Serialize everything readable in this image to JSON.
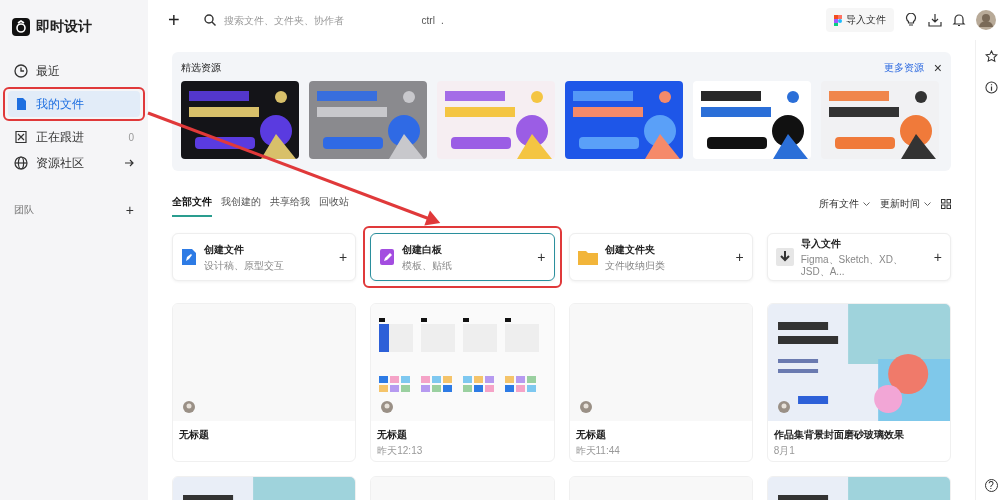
{
  "app": {
    "name": "即时设计"
  },
  "sidebar": {
    "items": [
      {
        "label": "最近",
        "selected": false,
        "marked": false
      },
      {
        "label": "我的文件",
        "selected": true,
        "marked": true
      },
      {
        "label": "正在跟进",
        "selected": false,
        "marked": false,
        "count": "0"
      },
      {
        "label": "资源社区",
        "selected": false,
        "marked": false,
        "arrow": true
      }
    ],
    "section": {
      "label": "团队",
      "add": "+"
    }
  },
  "topbar": {
    "new_button": "+",
    "search": {
      "placeholder": "搜索文件、文件夹、协作者",
      "keys": [
        "ctrl",
        "."
      ]
    },
    "import_button": "导入文件"
  },
  "banner": {
    "title": "精选资源",
    "more_link": "更多资源",
    "close": "×",
    "items": [
      {
        "kind": "picture"
      },
      {
        "kind": "picture"
      },
      {
        "kind": "picture"
      },
      {
        "kind": "picture"
      },
      {
        "kind": "picture"
      },
      {
        "kind": "picture"
      }
    ]
  },
  "tabs": [
    {
      "label": "全部文件",
      "selected": true
    },
    {
      "label": "我创建的",
      "selected": false
    },
    {
      "label": "共享给我",
      "selected": false
    },
    {
      "label": "回收站",
      "selected": false
    }
  ],
  "filters": [
    "所有文件",
    "更新时间"
  ],
  "create_cards": [
    {
      "title": "创建文件",
      "subtitle": "设计稿、原型交互",
      "add": "+",
      "highlighted": false,
      "marked": false
    },
    {
      "title": "创建白板",
      "subtitle": "模板、贴纸",
      "add": "+",
      "highlighted": true,
      "marked": true
    },
    {
      "title": "创建文件夹",
      "subtitle": "文件收纳归类",
      "add": "+",
      "highlighted": false,
      "marked": false
    },
    {
      "title": "导入文件",
      "subtitle": "Figma、Sketch、XD、JSD、A...",
      "add": "+",
      "highlighted": false,
      "marked": false
    }
  ],
  "files": [
    {
      "title": "无标题",
      "kind": "blank"
    },
    {
      "title": "无标题",
      "time": "昨天12:13",
      "kind": "board"
    },
    {
      "title": "无标题",
      "time": "昨天11:44",
      "kind": "blank"
    },
    {
      "title": "作品集背景封面磨砂玻璃效果",
      "time": "8月1",
      "kind": "picture"
    },
    {
      "kind": "picture"
    },
    {
      "kind": "blank"
    },
    {
      "kind": "blank"
    },
    {
      "kind": "picture"
    }
  ],
  "pointer_arrow": true,
  "help_button": "?"
}
